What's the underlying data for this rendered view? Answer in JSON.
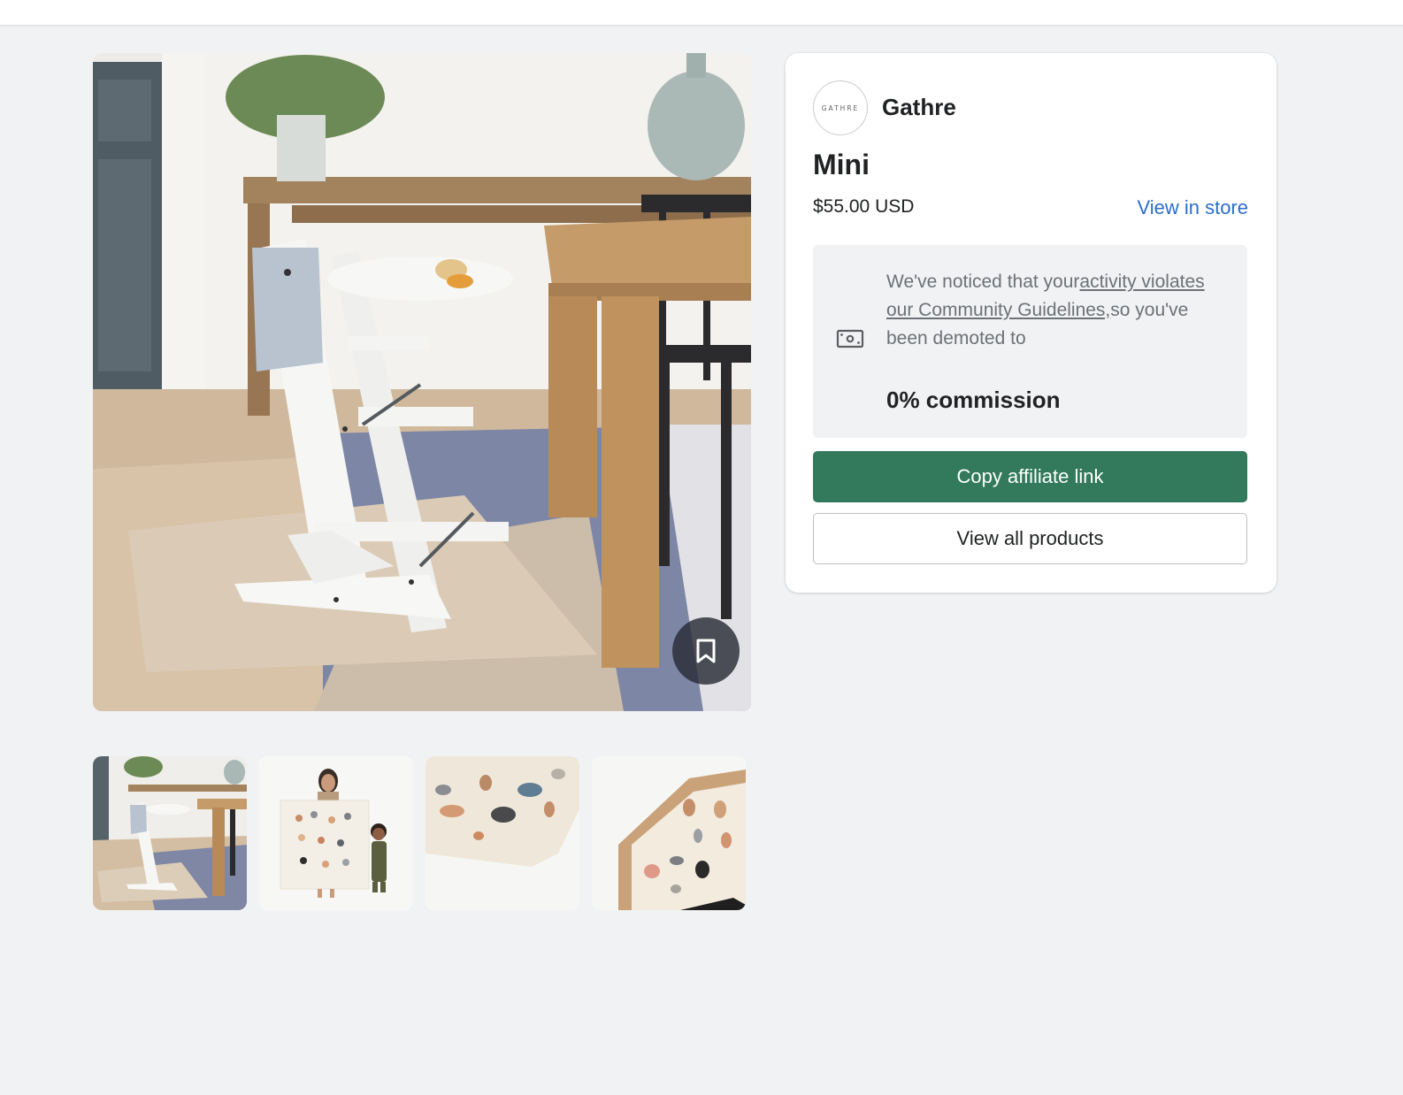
{
  "brand": {
    "logo_text": "GATHRE",
    "name": "Gathre"
  },
  "product": {
    "title": "Mini",
    "price": "$55.00 USD",
    "view_in_store_label": "View in store"
  },
  "notice": {
    "text_before": "We've noticed that your",
    "link_text": "activity violates our Community Guidelines,",
    "text_after": "so you've been demoted to",
    "commission": "0% commission",
    "icon": "money-bill-icon"
  },
  "actions": {
    "copy_link_label": "Copy affiliate link",
    "view_all_label": "View all products"
  },
  "gallery": {
    "bookmark_icon": "bookmark-icon",
    "thumbnails": [
      "high-chair-on-mat",
      "woman-and-child-holding-mat",
      "animal-mat-closeup",
      "folded-animal-mat"
    ]
  },
  "colors": {
    "primary_button": "#337a5c",
    "link": "#2c6ecb",
    "page_background": "#f1f2f4"
  }
}
